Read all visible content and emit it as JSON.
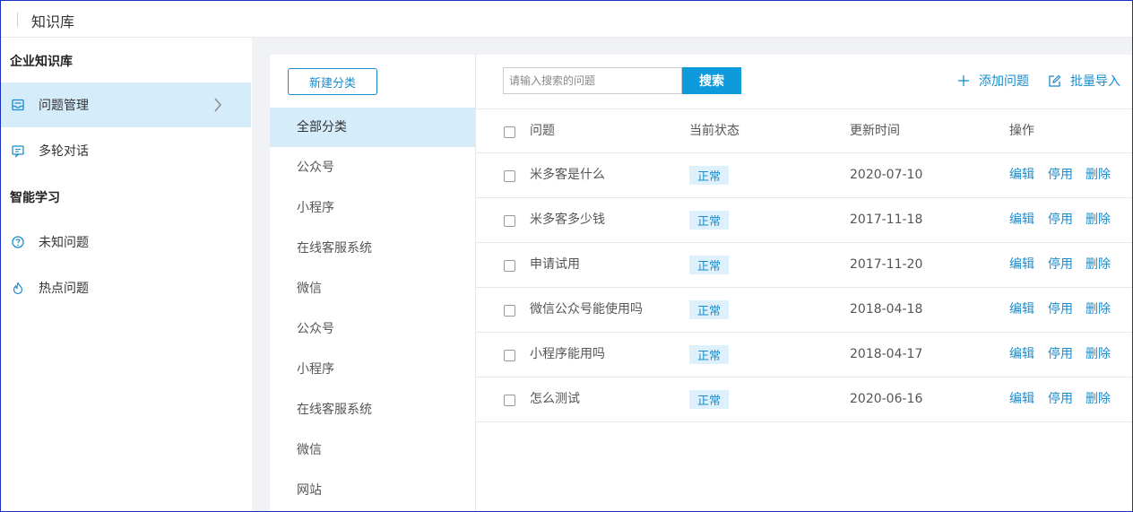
{
  "app": {
    "title": "知识库"
  },
  "sidebar": {
    "sections": [
      {
        "heading": "企业知识库"
      },
      {
        "heading": "智能学习"
      }
    ],
    "items": [
      {
        "label": "问题管理",
        "icon": "inbox-icon",
        "active": true
      },
      {
        "label": "多轮对话",
        "icon": "chat-icon"
      },
      {
        "label": "未知问题",
        "icon": "question-icon"
      },
      {
        "label": "热点问题",
        "icon": "flame-icon"
      }
    ]
  },
  "categories": {
    "new_label": "新建分类",
    "items": [
      "全部分类",
      "公众号",
      "小程序",
      "在线客服系统",
      "微信",
      "公众号",
      "小程序",
      "在线客服系统",
      "微信",
      "网站"
    ]
  },
  "toolbar": {
    "search_placeholder": "请输入搜索的问题",
    "search_label": "搜索",
    "add_label": "添加问题",
    "import_label": "批量导入"
  },
  "table": {
    "headers": {
      "question": "问题",
      "status": "当前状态",
      "updated": "更新时间",
      "ops": "操作"
    },
    "rows": [
      {
        "question": "米多客是什么",
        "status": "正常",
        "updated": "2020-07-10"
      },
      {
        "question": "米多客多少钱",
        "status": "正常",
        "updated": "2017-11-18"
      },
      {
        "question": "申请试用",
        "status": "正常",
        "updated": "2017-11-20"
      },
      {
        "question": "微信公众号能使用吗",
        "status": "正常",
        "updated": "2018-04-18"
      },
      {
        "question": "小程序能用吗",
        "status": "正常",
        "updated": "2018-04-17"
      },
      {
        "question": "怎么测试",
        "status": "正常",
        "updated": "2020-06-16"
      }
    ],
    "ops": {
      "edit": "编辑",
      "disable": "停用",
      "delete": "删除"
    }
  },
  "colors": {
    "accent": "#1a8ccc",
    "active_bg": "#d5ecfb",
    "search_btn": "#0e9bdc"
  }
}
